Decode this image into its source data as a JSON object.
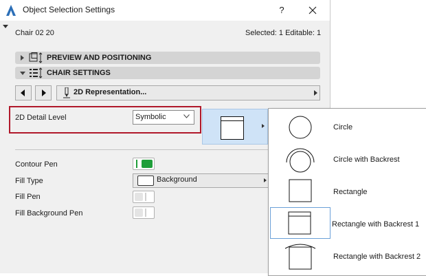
{
  "window": {
    "title": "Object Selection Settings",
    "help_label": "?"
  },
  "header": {
    "object_name": "Chair 02 20",
    "selection_info": "Selected: 1 Editable: 1"
  },
  "sections": [
    {
      "label": "PREVIEW AND POSITIONING",
      "expanded": false
    },
    {
      "label": "CHAIR SETTINGS",
      "expanded": true
    }
  ],
  "page_nav": {
    "current_page": "2D Representation..."
  },
  "detail_level": {
    "label": "2D Detail Level",
    "value": "Symbolic"
  },
  "params": {
    "contour_pen": {
      "label": "Contour Pen",
      "state": "on"
    },
    "fill_type": {
      "label": "Fill Type",
      "value": "Background"
    },
    "fill_pen": {
      "label": "Fill Pen",
      "state": "off"
    },
    "fill_bg_pen": {
      "label": "Fill Background Pen",
      "state": "off"
    }
  },
  "popup": {
    "options": [
      {
        "label": "Circle",
        "icon": "circle-icon"
      },
      {
        "label": "Circle with Backrest",
        "icon": "circle-with-backrest-icon"
      },
      {
        "label": "Rectangle",
        "icon": "rectangle-icon"
      },
      {
        "label": "Rectangle with Backrest 1",
        "icon": "rectangle-with-backrest-1-icon",
        "selected": true
      },
      {
        "label": "Rectangle with Backrest 2",
        "icon": "rectangle-with-backrest-2-icon"
      }
    ]
  },
  "colors": {
    "highlight_border": "#b0182a",
    "toggle_on": "#1f9e3a",
    "preview_bg": "#cfe3f7",
    "selected_border": "#6aa0d8"
  }
}
